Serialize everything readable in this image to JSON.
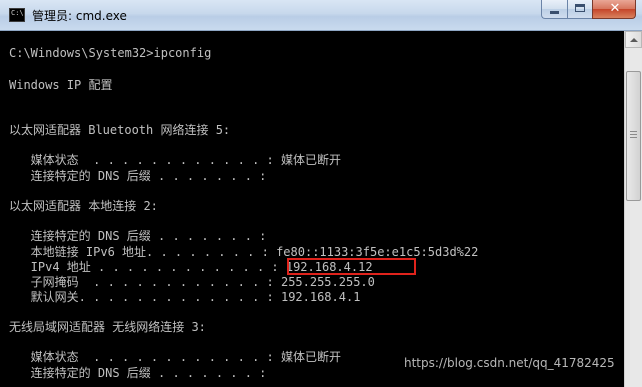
{
  "window": {
    "title": "管理员: cmd.exe",
    "icon": "cmd-icon",
    "icon_text": "C:\\"
  },
  "console": {
    "lines": [
      "C:\\Windows\\System32>ipconfig",
      "Windows IP 配置",
      "以太网适配器 Bluetooth 网络连接 5:",
      "   媒体状态  . . . . . . . . . . . . : 媒体已断开",
      "   连接特定的 DNS 后缀 . . . . . . . :",
      "以太网适配器 本地连接 2:",
      "   连接特定的 DNS 后缀 . . . . . . . :",
      "   本地链接 IPv6 地址. . . . . . . . : fe80::1133:3f5e:e1c5:5d3d%22",
      "   IPv4 地址 . . . . . . . . . . . . : 192.168.4.12",
      "   子网掩码  . . . . . . . . . . . . : 255.255.255.0",
      "   默认网关. . . . . . . . . . . . . : 192.168.4.1",
      "无线局域网适配器 无线网络连接 3:",
      "   媒体状态  . . . . . . . . . . . . : 媒体已断开",
      "   连接特定的 DNS 后缀 . . . . . . . :"
    ]
  },
  "watermark": "https://blog.csdn.net/qq_41782425",
  "colors": {
    "console_bg": "#000000",
    "console_text": "#c0c0c0",
    "highlight": "#e0231c"
  }
}
